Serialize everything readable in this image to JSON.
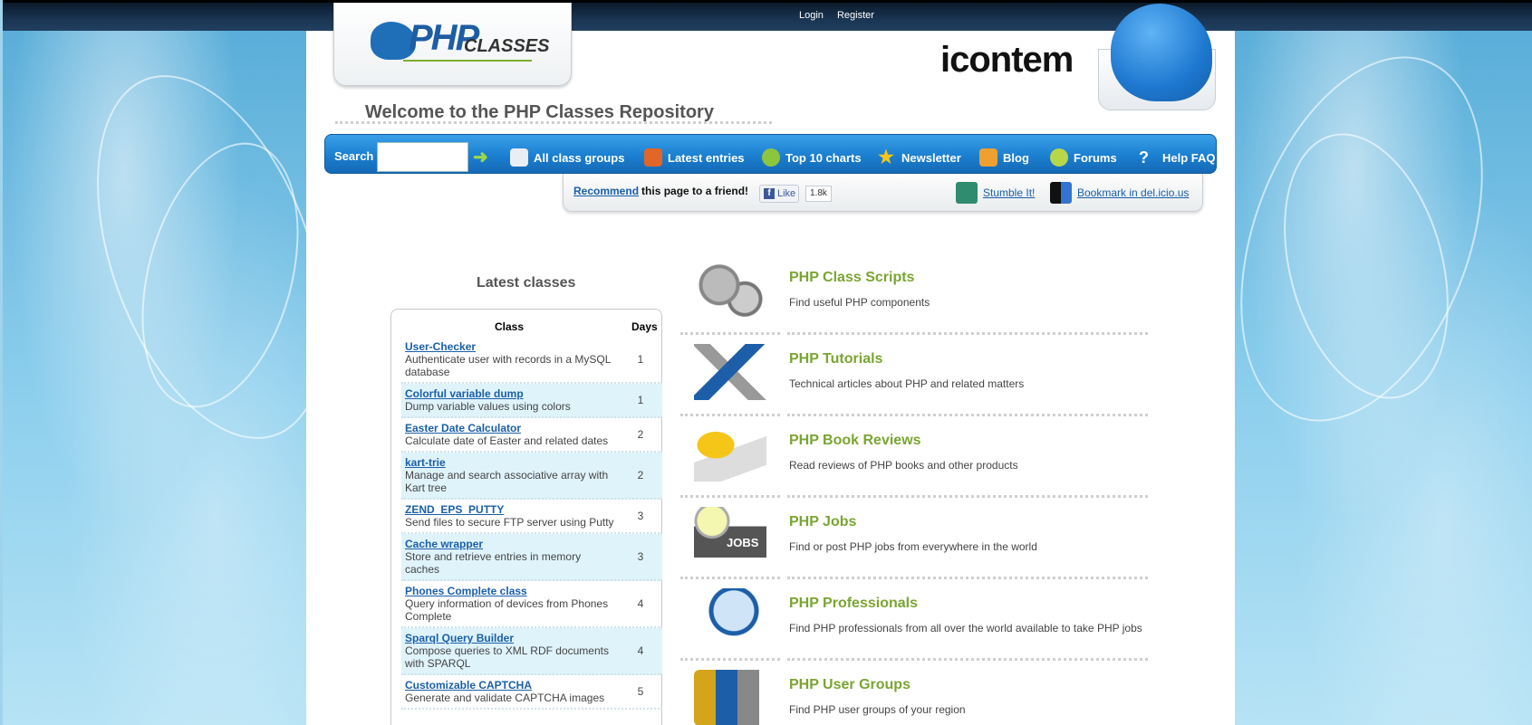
{
  "topbar": {
    "login": "Login",
    "register": "Register"
  },
  "brand": {
    "logo_php": "PHP",
    "logo_classes": "CLASSES",
    "sponsor": "icontem"
  },
  "welcome": "Welcome to the PHP Classes Repository",
  "nav": {
    "search_label": "Search",
    "items": [
      {
        "label": "All class groups",
        "icon": "groups-icon",
        "color": "#e8eef4"
      },
      {
        "label": "Latest entries",
        "icon": "rss-icon",
        "color": "#e0662a"
      },
      {
        "label": "Top 10 charts",
        "icon": "top10-icon",
        "color": "#8cc63f"
      },
      {
        "label": "Newsletter",
        "icon": "star-icon",
        "color": "#f5c518"
      },
      {
        "label": "Blog",
        "icon": "blog-icon",
        "color": "#f0a030"
      },
      {
        "label": "Forums",
        "icon": "forums-icon",
        "color": "#b8d64a"
      },
      {
        "label": "Help FAQ",
        "icon": "question-icon",
        "color": "#ffffff"
      }
    ]
  },
  "subbar": {
    "recommend_link": "Recommend",
    "recommend_text": "this page to a friend!",
    "like": "Like",
    "like_count": "1.8k",
    "stumble": "Stumble It!",
    "delicious": "Bookmark in del.icio.us"
  },
  "latest": {
    "title": "Latest classes",
    "col_class": "Class",
    "col_days": "Days",
    "rows": [
      {
        "name": "User-Checker",
        "desc": "Authenticate user with records in a MySQL database",
        "days": "1"
      },
      {
        "name": "Colorful variable dump",
        "desc": "Dump variable values using colors",
        "days": "1"
      },
      {
        "name": "Easter Date Calculator",
        "desc": "Calculate date of Easter and related dates",
        "days": "2"
      },
      {
        "name": "kart-trie",
        "desc": "Manage and search associative array with Kart tree",
        "days": "2"
      },
      {
        "name": "ZEND_EPS_PUTTY",
        "desc": "Send files to secure FTP server using Putty",
        "days": "3"
      },
      {
        "name": "Cache wrapper",
        "desc": "Store and retrieve entries in memory caches",
        "days": "3"
      },
      {
        "name": "Phones Complete class",
        "desc": "Query information of devices from Phones Complete",
        "days": "4"
      },
      {
        "name": "Sparql Query Builder",
        "desc": "Compose queries to XML RDF documents with SPARQL",
        "days": "4"
      },
      {
        "name": "Customizable CAPTCHA",
        "desc": "Generate and validate CAPTCHA images",
        "days": "5"
      }
    ]
  },
  "features": [
    {
      "title": "PHP Class Scripts",
      "desc": "Find useful PHP components",
      "icon": "gears-icon"
    },
    {
      "title": "PHP Tutorials",
      "desc": "Technical articles about PHP and related matters",
      "icon": "tools-icon"
    },
    {
      "title": "PHP Book Reviews",
      "desc": "Read reviews of PHP books and other products",
      "icon": "book-icon"
    },
    {
      "title": "PHP Jobs",
      "desc": "Find or post PHP jobs from everywhere in the world",
      "icon": "jobs-icon",
      "badge": "JOBS"
    },
    {
      "title": "PHP Professionals",
      "desc": "Find PHP professionals from all over the world available to take PHP jobs",
      "icon": "magnifier-icon"
    },
    {
      "title": "PHP User Groups",
      "desc": "Find PHP user groups of your region",
      "icon": "people-icon"
    }
  ]
}
